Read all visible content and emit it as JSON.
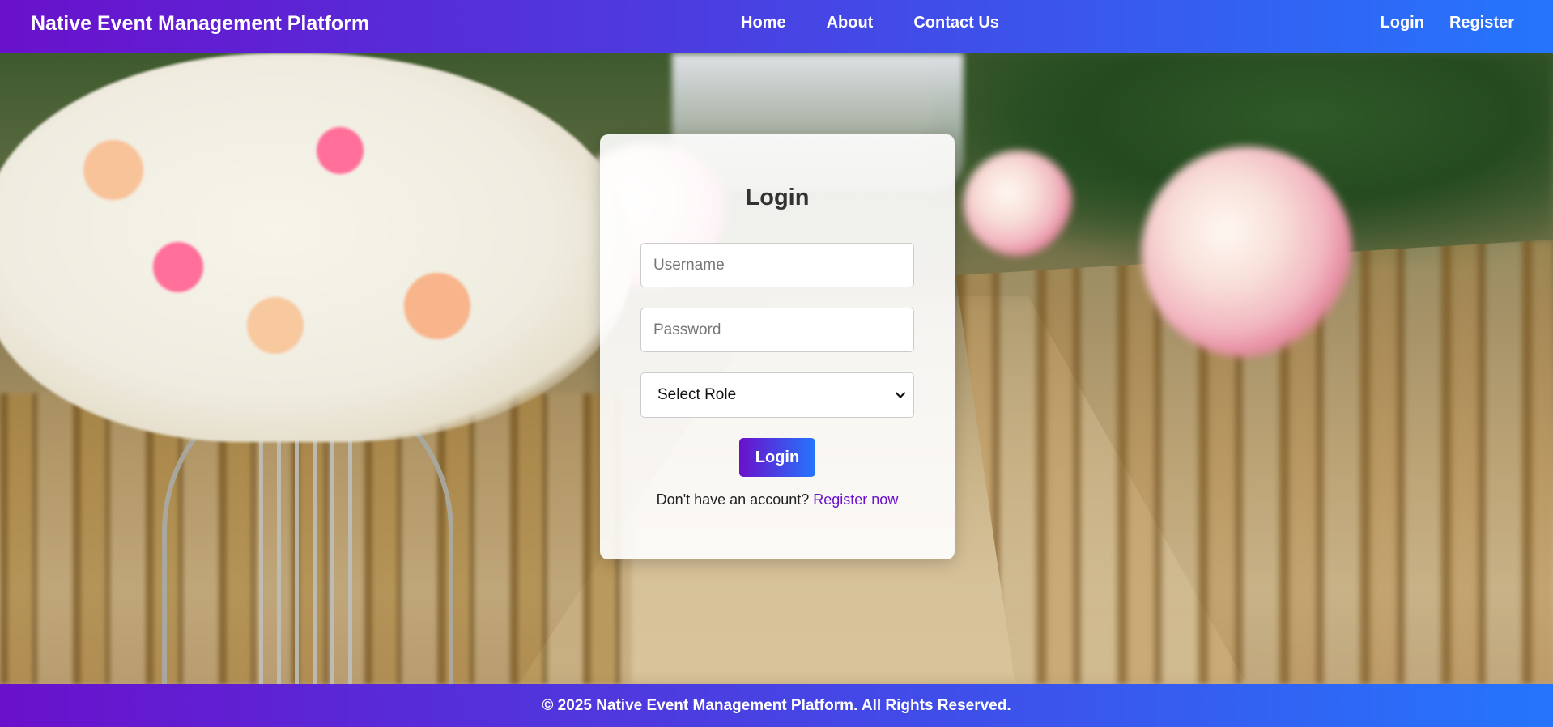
{
  "header": {
    "brand": "Native Event Management Platform",
    "nav_center": [
      "Home",
      "About",
      "Contact Us"
    ],
    "nav_right": [
      "Login",
      "Register"
    ]
  },
  "login_card": {
    "title": "Login",
    "username_placeholder": "Username",
    "password_placeholder": "Password",
    "role_select_value": "Select Role",
    "submit_label": "Login",
    "signup_prompt": "Don't have an account?",
    "signup_link": "Register now"
  },
  "footer": {
    "text": "© 2025 Native Event Management Platform. All Rights Reserved."
  },
  "colors": {
    "gradient_start": "#6a11cb",
    "gradient_end": "#2575fc",
    "link": "#6a11cb"
  },
  "icons": {
    "select_chevron": "chevron-down-icon"
  }
}
